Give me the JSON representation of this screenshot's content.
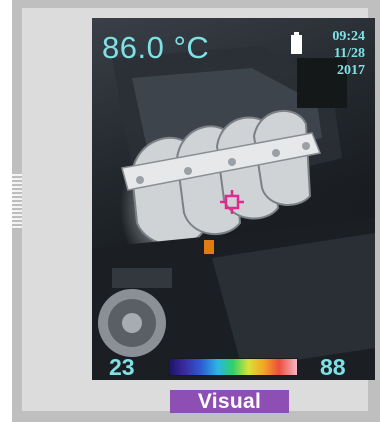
{
  "screen": {
    "temperature": "86.0 °C",
    "time": "09:24",
    "date": "11/28",
    "year": "2017",
    "battery_icon": "battery-icon",
    "crosshair_icon": "crosshair-icon",
    "range_min": "23",
    "range_max": "88",
    "text_color": "#7fe0e6",
    "crosshair_color": "#e02a8f"
  },
  "mode": {
    "label": "Visual",
    "color": "#8d4fb3"
  }
}
